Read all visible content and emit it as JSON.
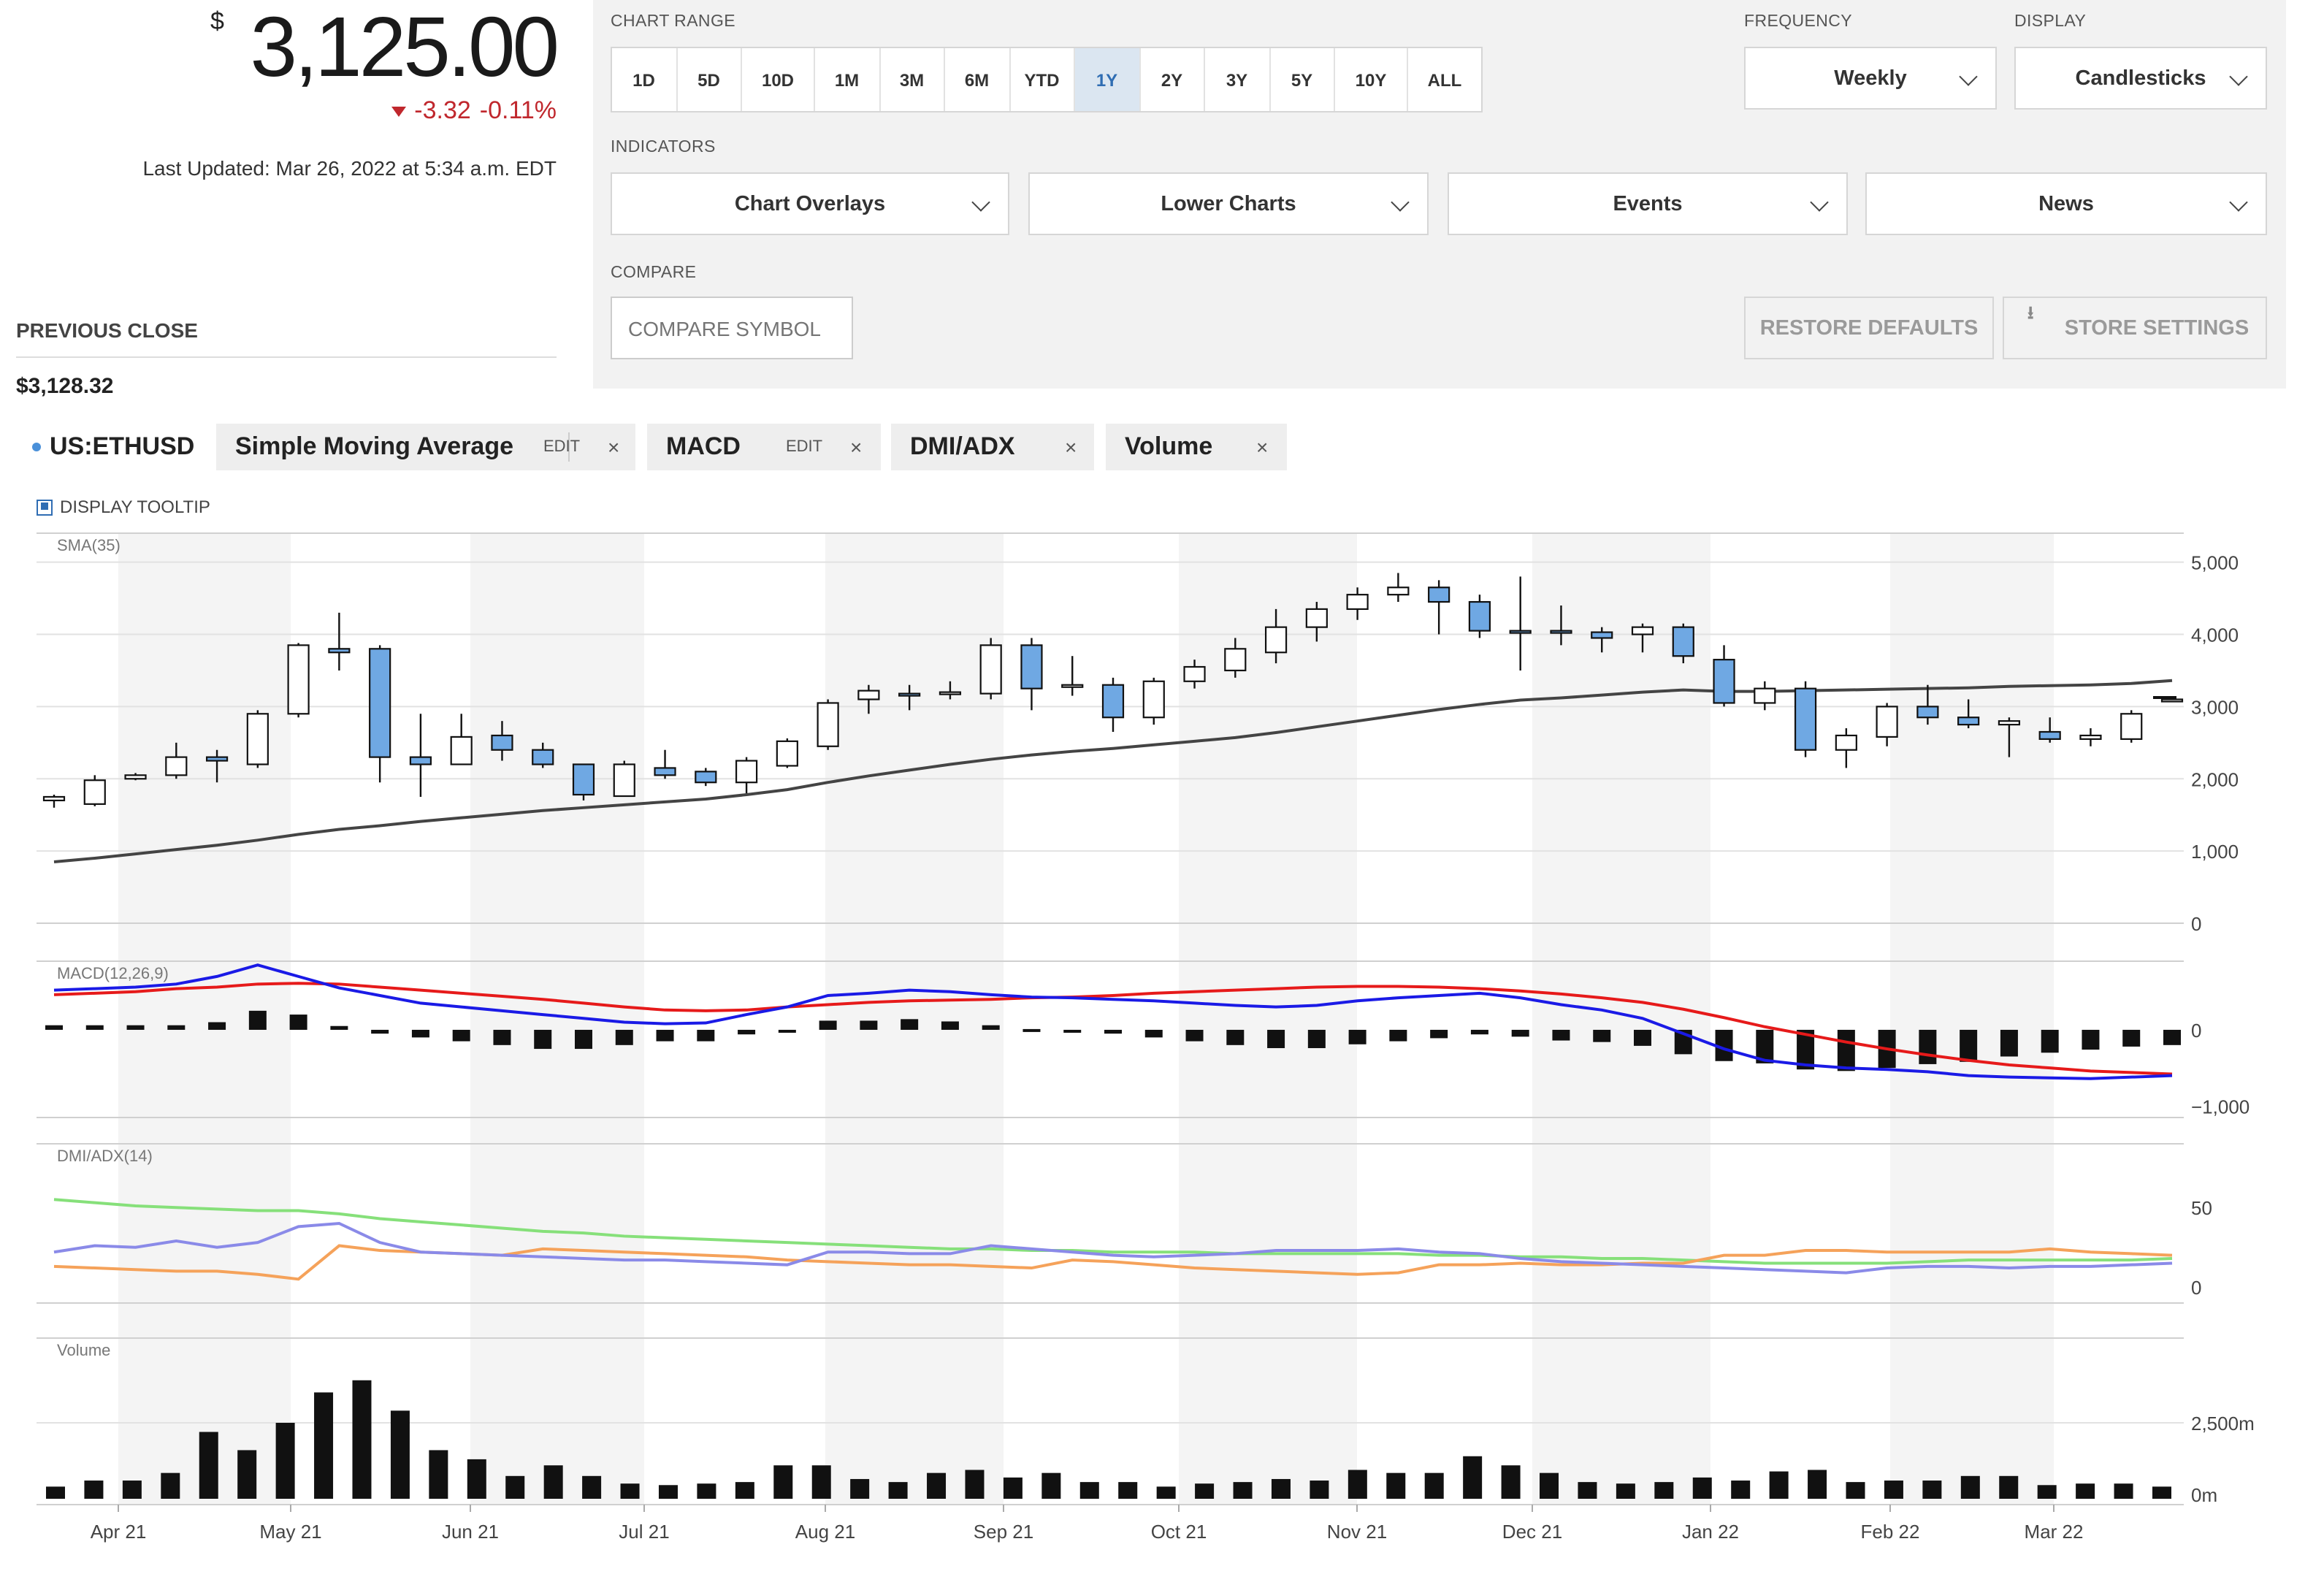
{
  "quote": {
    "currency_symbol": "$",
    "price": "3,125.00",
    "change": "-3.32",
    "change_pct": "-0.11%",
    "last_updated": "Last Updated: Mar 26, 2022 at 5:34 a.m. EDT",
    "prev_close_label": "PREVIOUS CLOSE",
    "prev_close": "$3,128.32"
  },
  "controls": {
    "chart_range_label": "CHART RANGE",
    "ranges": [
      "1D",
      "5D",
      "10D",
      "1M",
      "3M",
      "6M",
      "YTD",
      "1Y",
      "2Y",
      "3Y",
      "5Y",
      "10Y",
      "ALL"
    ],
    "active_range": "1Y",
    "frequency_label": "FREQUENCY",
    "frequency": "Weekly",
    "display_label": "DISPLAY",
    "display": "Candlesticks",
    "indicators_label": "INDICATORS",
    "indicators": [
      "Chart Overlays",
      "Lower Charts",
      "Events",
      "News"
    ],
    "compare_label": "COMPARE",
    "compare_placeholder": "COMPARE SYMBOL",
    "restore_label": "RESTORE DEFAULTS",
    "store_label": "STORE SETTINGS"
  },
  "legend": {
    "symbol": "US:ETHUSD",
    "sma": "Simple Moving Average",
    "macd": "MACD",
    "dmi": "DMI/ADX",
    "volume": "Volume",
    "edit": "EDIT",
    "close": "×",
    "tooltip_label": "DISPLAY TOOLTIP"
  },
  "colors": {
    "accent": "#2f6db3",
    "down": "#c0272d",
    "candle_down_fill": "#6fa8e3",
    "sma_line": "#444444",
    "macd_line": "#1a1ae6",
    "signal_line": "#e61a1a",
    "adx_line": "#86e07a",
    "plus_di": "#8a8ae8",
    "minus_di": "#f5a25a"
  },
  "chart_data": {
    "type": "candlestick",
    "x_labels": [
      "Apr 21",
      "May 21",
      "Jun 21",
      "Jul 21",
      "Aug 21",
      "Sep 21",
      "Oct 21",
      "Nov 21",
      "Dec 21",
      "Jan 22",
      "Feb 22",
      "Mar 22"
    ],
    "price_panel": {
      "label": "SMA(35)",
      "yticks": [
        "5,000",
        "4,000",
        "3,000",
        "2,000",
        "1,000",
        "0"
      ],
      "ylim": [
        0,
        5300
      ],
      "candles": [
        [
          1700,
          1750,
          1600,
          1780
        ],
        [
          1650,
          1980,
          1620,
          2050
        ],
        [
          2000,
          2050,
          1980,
          2080
        ],
        [
          2050,
          2300,
          2000,
          2500
        ],
        [
          2300,
          2250,
          1950,
          2400
        ],
        [
          2200,
          2900,
          2150,
          2950
        ],
        [
          2900,
          3850,
          2850,
          3880
        ],
        [
          3800,
          3750,
          3500,
          4300
        ],
        [
          3800,
          2300,
          1950,
          3850
        ],
        [
          2300,
          2200,
          1750,
          2900
        ],
        [
          2200,
          2580,
          2200,
          2900
        ],
        [
          2600,
          2400,
          2250,
          2800
        ],
        [
          2400,
          2200,
          2150,
          2500
        ],
        [
          2200,
          1780,
          1700,
          2200
        ],
        [
          1760,
          2200,
          1760,
          2250
        ],
        [
          2150,
          2050,
          2000,
          2400
        ],
        [
          2100,
          1950,
          1900,
          2150
        ],
        [
          1950,
          2250,
          1800,
          2300
        ],
        [
          2180,
          2520,
          2150,
          2560
        ],
        [
          2450,
          3050,
          2400,
          3100
        ],
        [
          3100,
          3220,
          2900,
          3300
        ],
        [
          3180,
          3160,
          2950,
          3300
        ],
        [
          3180,
          3200,
          3100,
          3350
        ],
        [
          3180,
          3850,
          3100,
          3950
        ],
        [
          3850,
          3250,
          2950,
          3950
        ],
        [
          3300,
          3300,
          3150,
          3700
        ],
        [
          3300,
          2850,
          2650,
          3400
        ],
        [
          2850,
          3350,
          2750,
          3400
        ],
        [
          3350,
          3550,
          3250,
          3650
        ],
        [
          3500,
          3800,
          3400,
          3950
        ],
        [
          3750,
          4100,
          3600,
          4350
        ],
        [
          4100,
          4350,
          3900,
          4450
        ],
        [
          4350,
          4550,
          4200,
          4650
        ],
        [
          4550,
          4650,
          4450,
          4850
        ],
        [
          4650,
          4450,
          4000,
          4750
        ],
        [
          4450,
          4050,
          3950,
          4550
        ],
        [
          4050,
          4030,
          3500,
          4800
        ],
        [
          4050,
          4020,
          3850,
          4400
        ],
        [
          4030,
          3950,
          3750,
          4100
        ],
        [
          4000,
          4100,
          3750,
          4150
        ],
        [
          4100,
          3700,
          3600,
          4150
        ],
        [
          3650,
          3050,
          3000,
          3850
        ],
        [
          3050,
          3250,
          2950,
          3350
        ],
        [
          3250,
          2400,
          2300,
          3350
        ],
        [
          2400,
          2600,
          2150,
          2700
        ],
        [
          2580,
          3000,
          2450,
          3050
        ],
        [
          3000,
          2850,
          2750,
          3300
        ],
        [
          2850,
          2750,
          2700,
          3100
        ],
        [
          2750,
          2800,
          2300,
          2850
        ],
        [
          2650,
          2550,
          2500,
          2850
        ],
        [
          2550,
          2600,
          2450,
          2700
        ],
        [
          2550,
          2900,
          2500,
          2950
        ],
        [
          3100,
          3100,
          3100,
          3100
        ]
      ],
      "sma": [
        850,
        900,
        960,
        1020,
        1080,
        1150,
        1230,
        1300,
        1350,
        1410,
        1460,
        1510,
        1560,
        1600,
        1640,
        1680,
        1720,
        1780,
        1850,
        1950,
        2040,
        2120,
        2200,
        2270,
        2330,
        2380,
        2420,
        2470,
        2520,
        2570,
        2640,
        2720,
        2800,
        2880,
        2960,
        3030,
        3090,
        3120,
        3160,
        3200,
        3230,
        3210,
        3210,
        3220,
        3230,
        3240,
        3250,
        3260,
        3280,
        3290,
        3300,
        3320,
        3360
      ]
    },
    "macd_panel": {
      "label": "MACD(12,26,9)",
      "yticks": [
        "0",
        "−1,000"
      ],
      "ylim": [
        -1150,
        900
      ],
      "macd": [
        520,
        540,
        560,
        600,
        700,
        850,
        700,
        550,
        450,
        350,
        300,
        250,
        200,
        150,
        100,
        80,
        90,
        200,
        300,
        450,
        480,
        520,
        500,
        460,
        430,
        420,
        400,
        380,
        350,
        320,
        300,
        320,
        380,
        420,
        450,
        480,
        420,
        330,
        260,
        150,
        -50,
        -250,
        -400,
        -460,
        -500,
        -520,
        -550,
        -600,
        -620,
        -630,
        -640,
        -620,
        -600
      ],
      "signal": [
        460,
        480,
        500,
        540,
        560,
        600,
        610,
        600,
        560,
        520,
        480,
        440,
        400,
        350,
        300,
        260,
        250,
        260,
        300,
        330,
        360,
        380,
        390,
        400,
        420,
        430,
        450,
        480,
        500,
        520,
        540,
        560,
        570,
        570,
        560,
        540,
        510,
        470,
        420,
        360,
        270,
        160,
        40,
        -60,
        -160,
        -250,
        -330,
        -400,
        -460,
        -500,
        -540,
        -560,
        -580
      ],
      "histogram": [
        60,
        60,
        60,
        60,
        100,
        250,
        200,
        50,
        -50,
        -100,
        -150,
        -200,
        -250,
        -250,
        -200,
        -150,
        -150,
        -60,
        -30,
        120,
        120,
        140,
        110,
        60,
        10,
        -10,
        -50,
        -100,
        -150,
        -200,
        -240,
        -240,
        -190,
        -150,
        -110,
        -60,
        -90,
        -140,
        -160,
        -210,
        -320,
        -410,
        -440,
        -520,
        -540,
        -500,
        -450,
        -420,
        -350,
        -300,
        -260,
        -220,
        -200
      ]
    },
    "dmi_panel": {
      "label": "DMI/ADX(14)",
      "yticks": [
        "50",
        "0"
      ],
      "ylim": [
        -10,
        90
      ],
      "adx": [
        55,
        53,
        51,
        50,
        49,
        48,
        48,
        46,
        43,
        41,
        39,
        37,
        35,
        34,
        32,
        31,
        30,
        29,
        28,
        27,
        26,
        25,
        24,
        24,
        23,
        23,
        22,
        22,
        22,
        21,
        21,
        21,
        21,
        21,
        20,
        20,
        19,
        19,
        18,
        18,
        17,
        16,
        15,
        15,
        15,
        15,
        16,
        17,
        17,
        17,
        17,
        17,
        18
      ],
      "plus_di": [
        22,
        26,
        25,
        29,
        25,
        28,
        38,
        40,
        28,
        22,
        21,
        20,
        19,
        18,
        17,
        17,
        16,
        15,
        14,
        22,
        22,
        21,
        21,
        26,
        24,
        22,
        20,
        19,
        20,
        21,
        23,
        23,
        23,
        24,
        22,
        21,
        18,
        16,
        15,
        14,
        13,
        12,
        11,
        10,
        9,
        12,
        13,
        13,
        12,
        13,
        13,
        14,
        15
      ],
      "minus_di": [
        13,
        12,
        11,
        10,
        10,
        8,
        5,
        26,
        23,
        22,
        21,
        20,
        24,
        23,
        22,
        21,
        20,
        19,
        17,
        16,
        15,
        14,
        14,
        13,
        12,
        17,
        16,
        14,
        12,
        11,
        10,
        9,
        8,
        9,
        14,
        14,
        15,
        14,
        14,
        15,
        15,
        20,
        20,
        23,
        23,
        22,
        22,
        22,
        22,
        24,
        22,
        21,
        20
      ]
    },
    "volume_panel": {
      "label": "Volume",
      "yticks": [
        "2,500m",
        "0m"
      ],
      "ylim": [
        0,
        5000
      ],
      "values": [
        400,
        600,
        600,
        850,
        2200,
        1600,
        2500,
        3500,
        3900,
        2900,
        1600,
        1300,
        750,
        1100,
        750,
        500,
        450,
        500,
        550,
        1100,
        1100,
        650,
        550,
        850,
        950,
        700,
        850,
        550,
        550,
        400,
        500,
        550,
        650,
        600,
        950,
        850,
        850,
        1400,
        1100,
        850,
        550,
        500,
        550,
        700,
        600,
        900,
        950,
        550,
        600,
        600,
        750,
        750,
        450,
        500,
        500,
        400
      ]
    }
  }
}
